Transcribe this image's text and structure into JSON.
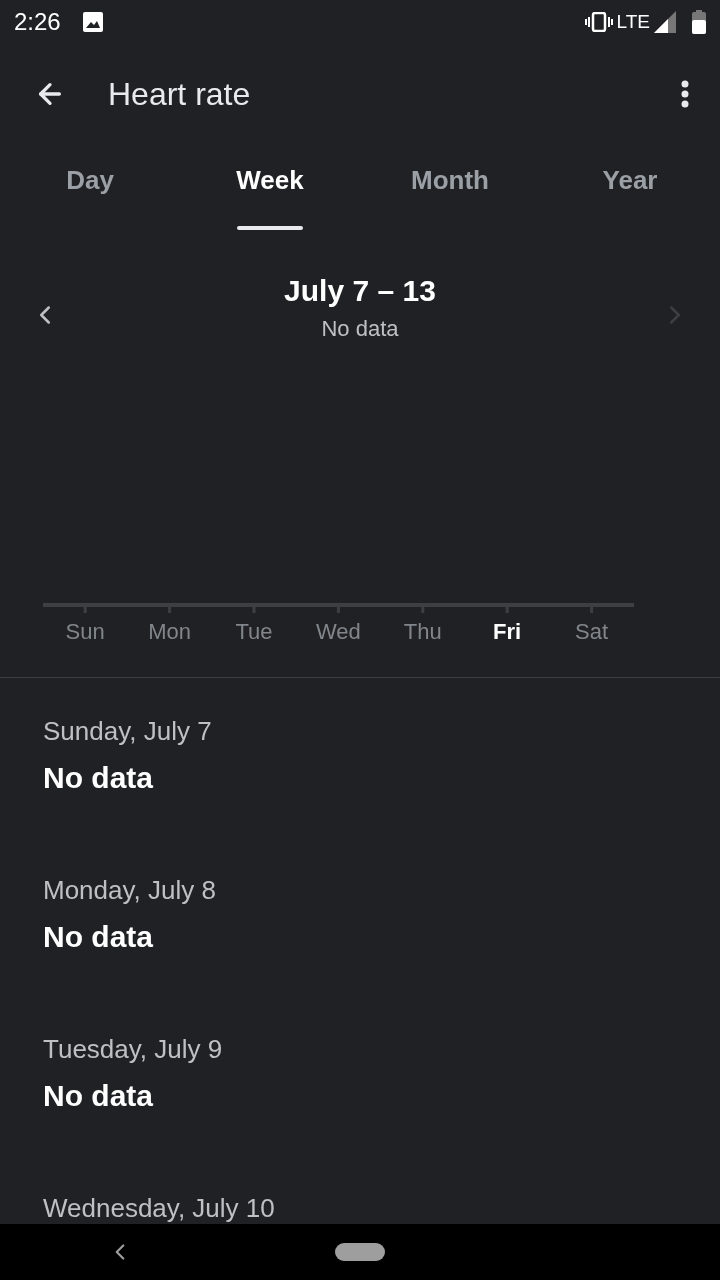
{
  "status_bar": {
    "time": "2:26",
    "network": "LTE"
  },
  "app_bar": {
    "title": "Heart rate"
  },
  "tabs": [
    {
      "label": "Day",
      "selected": false
    },
    {
      "label": "Week",
      "selected": true
    },
    {
      "label": "Month",
      "selected": false
    },
    {
      "label": "Year",
      "selected": false
    }
  ],
  "period": {
    "range": "July 7 – 13",
    "summary": "No data",
    "prev_disabled": false,
    "next_disabled": true
  },
  "chart": {
    "days": [
      {
        "label": "Sun",
        "selected": false
      },
      {
        "label": "Mon",
        "selected": false
      },
      {
        "label": "Tue",
        "selected": false
      },
      {
        "label": "Wed",
        "selected": false
      },
      {
        "label": "Thu",
        "selected": false
      },
      {
        "label": "Fri",
        "selected": true
      },
      {
        "label": "Sat",
        "selected": false
      }
    ]
  },
  "entries": [
    {
      "date": "Sunday, July 7",
      "value": "No data"
    },
    {
      "date": "Monday, July 8",
      "value": "No data"
    },
    {
      "date": "Tuesday, July 9",
      "value": "No data"
    },
    {
      "date": "Wednesday, July 10"
    }
  ]
}
